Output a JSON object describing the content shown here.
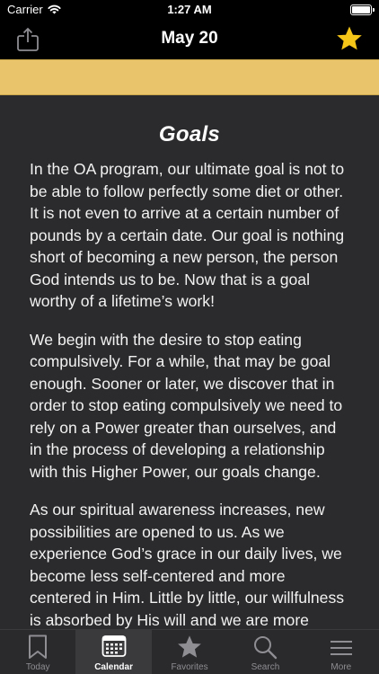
{
  "status_bar": {
    "carrier": "Carrier",
    "time": "1:27 AM"
  },
  "nav": {
    "title": "May 20",
    "share_icon": "share-icon",
    "star_icon": "star-icon",
    "star_color": "#f5c518"
  },
  "banner": {
    "color": "#e9c46a"
  },
  "reading": {
    "title": "Goals",
    "paragraphs": [
      "In the OA program, our ultimate goal is not to be able to follow perfectly some diet or other. It is not even to arrive at a certain number of pounds by a certain date. Our goal is nothing short of becoming a new person, the person God intends us to be. Now that is a goal worthy of a lifetime’s work!",
      "We begin with the desire to stop eating compulsively. For a while, that may be goal enough. Sooner or later, we discover that in order to stop eating compulsively we need to rely on a Power greater than ourselves, and in the process of developing a relationship with this Higher Power, our goals change.",
      "As our spiritual awareness increases, new possibilities are opened to us. As we experience God’s grace in our daily lives, we become less self-centered and more centered in Him. Little by little, our willfulness is absorbed by His will and we are more"
    ]
  },
  "tabs": [
    {
      "label": "Today",
      "icon": "bookmark-icon"
    },
    {
      "label": "Calendar",
      "icon": "calendar-icon",
      "active": true
    },
    {
      "label": "Favorites",
      "icon": "star-icon"
    },
    {
      "label": "Search",
      "icon": "search-icon"
    },
    {
      "label": "More",
      "icon": "menu-icon"
    }
  ]
}
